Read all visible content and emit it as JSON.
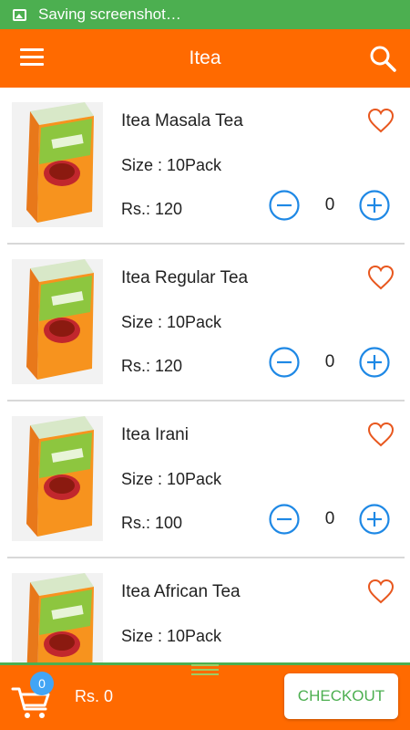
{
  "status_bar": {
    "text": "Saving screenshot…",
    "icon": "image-icon"
  },
  "app_bar": {
    "title": "Itea",
    "menu_icon": "hamburger-menu-icon",
    "search_icon": "search-icon"
  },
  "colors": {
    "primary": "#ff6a00",
    "status_green": "#4caf50",
    "accent_blue": "#1e88e5",
    "heart_orange": "#e8571e"
  },
  "products": [
    {
      "name": "Itea Masala Tea",
      "size": "Size : 10Pack",
      "price": "Rs.: 120",
      "quantity": "0"
    },
    {
      "name": "Itea Regular Tea",
      "size": "Size : 10Pack",
      "price": "Rs.: 120",
      "quantity": "0"
    },
    {
      "name": "Itea Irani",
      "size": "Size : 10Pack",
      "price": "Rs.: 100",
      "quantity": "0"
    },
    {
      "name": "Itea African Tea",
      "size": "Size : 10Pack",
      "price": "",
      "quantity": ""
    }
  ],
  "cart": {
    "count": "0",
    "total": "Rs. 0",
    "checkout_label": "CHECKOUT"
  }
}
